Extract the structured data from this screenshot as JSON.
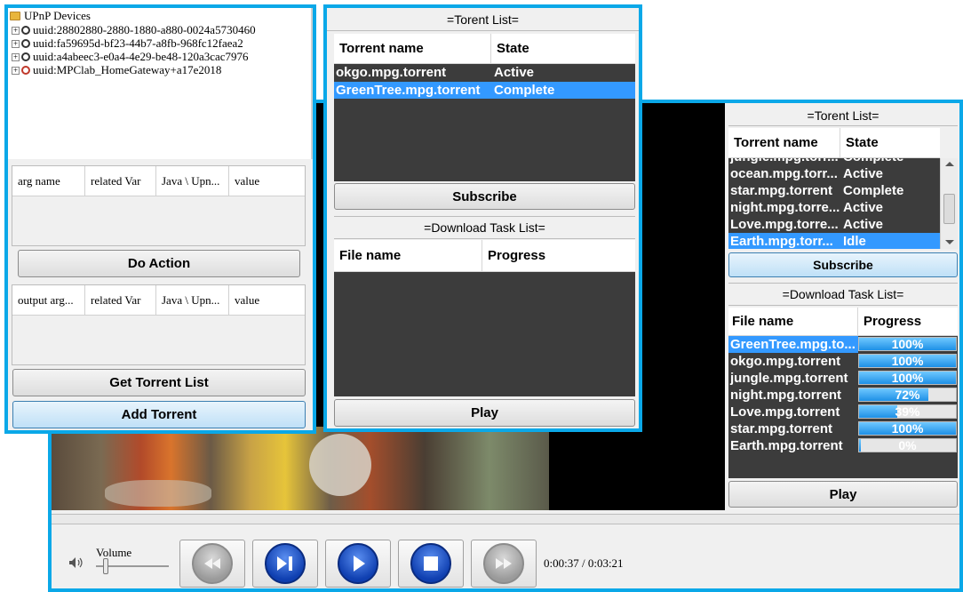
{
  "upnp": {
    "root_label": "UPnP Devices",
    "devices": [
      {
        "label": "uuid:28802880-2880-1880-a880-0024a5730460"
      },
      {
        "label": "uuid:fa59695d-bf23-44b7-a8fb-968fc12faea2"
      },
      {
        "label": "uuid:a4abeec3-e0a4-4e29-be48-120a3cac7976"
      },
      {
        "label": "uuid:MPClab_HomeGateway+a17e2018"
      }
    ],
    "args_table": {
      "columns": [
        "arg name",
        "related Var",
        "Java \\ Upn...",
        "value"
      ]
    },
    "do_action_label": "Do Action",
    "output_table": {
      "columns": [
        "output arg...",
        "related Var",
        "Java \\ Upn...",
        "value"
      ]
    },
    "get_torrent_list_label": "Get Torrent List",
    "add_torrent_label": "Add Torrent"
  },
  "torrent_window": {
    "title": "=Torent List=",
    "columns": {
      "name": "Torrent name",
      "state": "State"
    },
    "rows": [
      {
        "name": "okgo.mpg.torrent",
        "state": "Active",
        "selected": false
      },
      {
        "name": "GreenTree.mpg.torrent",
        "state": "Complete",
        "selected": true
      }
    ],
    "subscribe_label": "Subscribe",
    "download_title": "=Download Task List=",
    "download_columns": {
      "file": "File name",
      "progress": "Progress"
    },
    "play_label": "Play"
  },
  "right_panel": {
    "title": "=Torent List=",
    "columns": {
      "name": "Torrent name",
      "state": "State"
    },
    "partial_row": {
      "name": "jungle.mpg.torr...",
      "state": "Complete"
    },
    "rows": [
      {
        "name": "ocean.mpg.torr...",
        "state": "Active",
        "selected": false
      },
      {
        "name": "star.mpg.torrent",
        "state": "Complete",
        "selected": false
      },
      {
        "name": "night.mpg.torre...",
        "state": "Active",
        "selected": false
      },
      {
        "name": "Love.mpg.torre...",
        "state": "Active",
        "selected": false
      },
      {
        "name": "Earth.mpg.torr...",
        "state": "Idle",
        "selected": true
      }
    ],
    "subscribe_label": "Subscribe",
    "download_title": "=Download Task List=",
    "download_columns": {
      "file": "File name",
      "progress": "Progress"
    },
    "downloads": [
      {
        "file": "GreenTree.mpg.to...",
        "progress_text": "100%",
        "progress": 100,
        "selected": true
      },
      {
        "file": "okgo.mpg.torrent",
        "progress_text": "100%",
        "progress": 100,
        "selected": false
      },
      {
        "file": "jungle.mpg.torrent",
        "progress_text": "100%",
        "progress": 100,
        "selected": false
      },
      {
        "file": "night.mpg.torrent",
        "progress_text": "72%",
        "progress": 72,
        "selected": false
      },
      {
        "file": "Love.mpg.torrent",
        "progress_text": "39%",
        "progress": 39,
        "selected": false
      },
      {
        "file": "star.mpg.torrent",
        "progress_text": "100%",
        "progress": 100,
        "selected": false
      },
      {
        "file": "Earth.mpg.torrent",
        "progress_text": "0%",
        "progress": 0,
        "selected": false
      }
    ],
    "play_label": "Play"
  },
  "player": {
    "volume_label": "Volume",
    "time_text": "0:00:37 / 0:03:21",
    "buttons": [
      {
        "name": "rewind",
        "icon": "rewind-icon",
        "enabled": false
      },
      {
        "name": "play-pause",
        "icon": "play-pause-icon",
        "enabled": true
      },
      {
        "name": "play",
        "icon": "play-icon",
        "enabled": true
      },
      {
        "name": "stop",
        "icon": "stop-icon",
        "enabled": true
      },
      {
        "name": "fast-forward",
        "icon": "fast-forward-icon",
        "enabled": false
      }
    ]
  },
  "colors": {
    "accent_border": "#0aa8e8",
    "selection": "#3399ff",
    "list_bg": "#3c3c3c"
  }
}
